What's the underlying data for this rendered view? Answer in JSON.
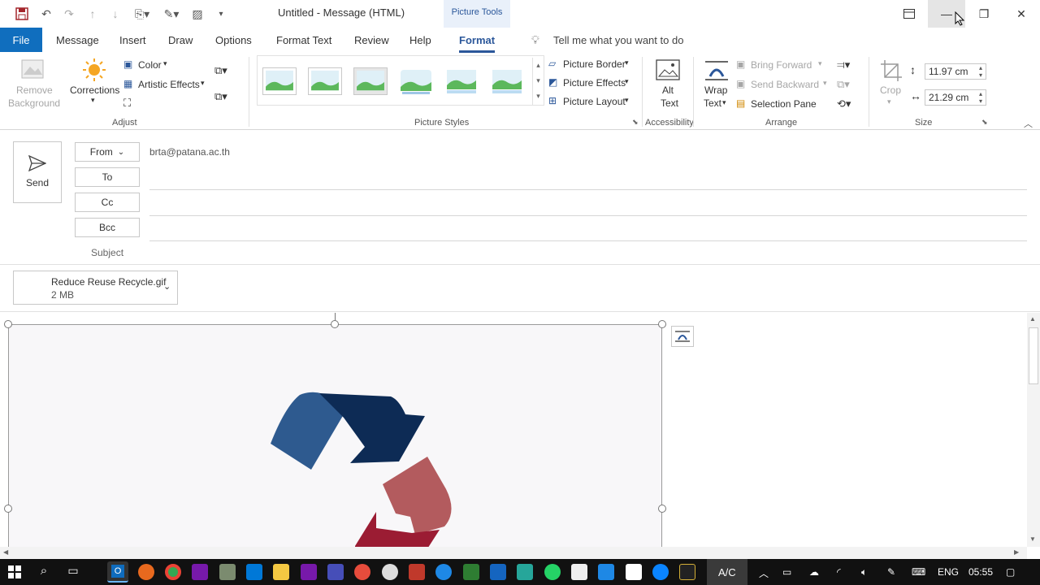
{
  "window": {
    "title": "Untitled  -  Message (HTML)",
    "context_tab": "Picture Tools"
  },
  "tabs": [
    "File",
    "Message",
    "Insert",
    "Draw",
    "Options",
    "Format Text",
    "Review",
    "Help",
    "Format"
  ],
  "tell_me": "Tell me what you want to do",
  "ribbon": {
    "adjust": {
      "remove_background_l1": "Remove",
      "remove_background_l2": "Background",
      "corrections": "Corrections",
      "color": "Color",
      "artistic_effects": "Artistic Effects",
      "label": "Adjust"
    },
    "picture_styles": {
      "label": "Picture Styles",
      "picture_border": "Picture Border",
      "picture_effects": "Picture Effects",
      "picture_layout": "Picture Layout"
    },
    "accessibility": {
      "alt_text_l1": "Alt",
      "alt_text_l2": "Text",
      "label": "Accessibility"
    },
    "arrange": {
      "wrap_text_l1": "Wrap",
      "wrap_text_l2": "Text",
      "bring_forward": "Bring Forward",
      "send_backward": "Send Backward",
      "selection_pane": "Selection Pane",
      "label": "Arrange"
    },
    "size": {
      "crop": "Crop",
      "height": "11.97 cm",
      "width": "21.29 cm",
      "label": "Size"
    }
  },
  "compose": {
    "send": "Send",
    "from_label": "From",
    "from_value": "brta@patana.ac.th",
    "to_label": "To",
    "cc_label": "Cc",
    "bcc_label": "Bcc",
    "subject_label": "Subject",
    "attachment_name": "Reduce Reuse Recycle.gif",
    "attachment_size": "2 MB"
  },
  "taskbar": {
    "ac": "A/C",
    "lang": "ENG",
    "time": "05:55"
  },
  "colors": {
    "accent": "#2b579a",
    "file_tab": "#106ebe",
    "recycle_blue_light": "#2e5a8f",
    "recycle_blue_dark": "#0d2b55",
    "recycle_red_light": "#b35b5e",
    "recycle_red_dark": "#9b1c33"
  }
}
